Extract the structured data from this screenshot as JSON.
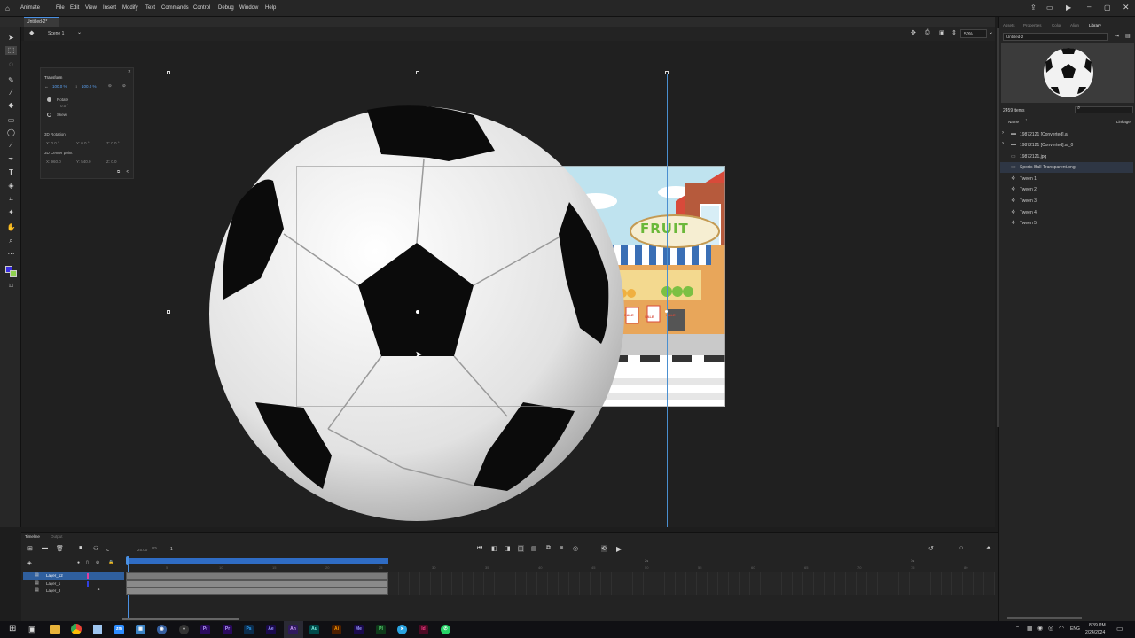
{
  "app": {
    "name": "Animate"
  },
  "menu": [
    "File",
    "Edit",
    "View",
    "Insert",
    "Modify",
    "Text",
    "Commands",
    "Control",
    "Debug",
    "Window",
    "Help"
  ],
  "document": {
    "tab": "Untitled-2*",
    "scene": "Scene 1",
    "zoom": "50%"
  },
  "transform": {
    "title": "Transform",
    "scale_w": "100.0 %",
    "scale_h": "100.0 %",
    "rotate_label": "Rotate",
    "rotate_value": "0.0 °",
    "skew_label": "Skew",
    "rotation3d_label": "3D Rotation",
    "rot_x": "X: 0.0 °",
    "rot_y": "Y: 0.0 °",
    "rot_z": "Z: 0.0 °",
    "center_label": "3D Center point",
    "center_x": "X: 960.0",
    "center_y": "Y: 540.0",
    "center_z": "Z: 0.0"
  },
  "stage": {
    "sign_text": "FRUIT",
    "sale_text": "SALE"
  },
  "right_panel": {
    "tabs": [
      "Assets",
      "Properties",
      "Color",
      "Align",
      "Library"
    ],
    "active_tab": "Library",
    "doc_select": "Untitled-2",
    "item_count": "2459 items",
    "col_name": "Name",
    "col_linkage": "Linkage",
    "items": [
      {
        "label": "19872121 [Converted].ai",
        "icon": "folder-icon"
      },
      {
        "label": "19872121 [Converted].ai_0",
        "icon": "folder-icon"
      },
      {
        "label": "19872121.jpg",
        "icon": "image-icon"
      },
      {
        "label": "Sports-Ball-Transparent.png",
        "icon": "image-icon"
      },
      {
        "label": "Tween 1",
        "icon": "symbol-icon"
      },
      {
        "label": "Tween 2",
        "icon": "symbol-icon"
      },
      {
        "label": "Tween 3",
        "icon": "symbol-icon"
      },
      {
        "label": "Tween 4",
        "icon": "symbol-icon"
      },
      {
        "label": "Tween 5",
        "icon": "symbol-icon"
      }
    ]
  },
  "timeline": {
    "tabs": [
      "Timeline",
      "Output"
    ],
    "fps": "25.00",
    "fps_unit": "FPS",
    "frame": "1",
    "layers": [
      "Layer_12",
      "Layer_1",
      "Layer_8"
    ],
    "ruler": [
      "5",
      "10",
      "15",
      "20",
      "25",
      "30",
      "35",
      "40",
      "45",
      "50",
      "55",
      "60",
      "65",
      "70",
      "75",
      "80"
    ],
    "sec_marks": [
      "2s",
      "3s"
    ]
  },
  "taskbar": {
    "time": "8:39 PM",
    "date": "2/24/2024",
    "lang": "ENG",
    "apps": [
      {
        "label": "zm",
        "color": "#2d8cff"
      },
      {
        "label": "Pr",
        "color": "#2a0a5e"
      },
      {
        "label": "Pr",
        "color": "#2a0a5e"
      },
      {
        "label": "Ps",
        "color": "#0c2d4d"
      },
      {
        "label": "Ae",
        "color": "#1a0a4d"
      },
      {
        "label": "An",
        "color": "#2f1a5e"
      },
      {
        "label": "Au",
        "color": "#004a4a"
      },
      {
        "label": "Ai",
        "color": "#4d1f00"
      },
      {
        "label": "Me",
        "color": "#1a0a4d"
      },
      {
        "label": "Pl",
        "color": "#0e3a1a"
      },
      {
        "label": "Id",
        "color": "#4d0a24"
      }
    ]
  },
  "colors": {
    "accent": "#4a90e2",
    "tween": "#777777",
    "stroke": "#3b2fe0",
    "fill": "#8fd14f"
  }
}
